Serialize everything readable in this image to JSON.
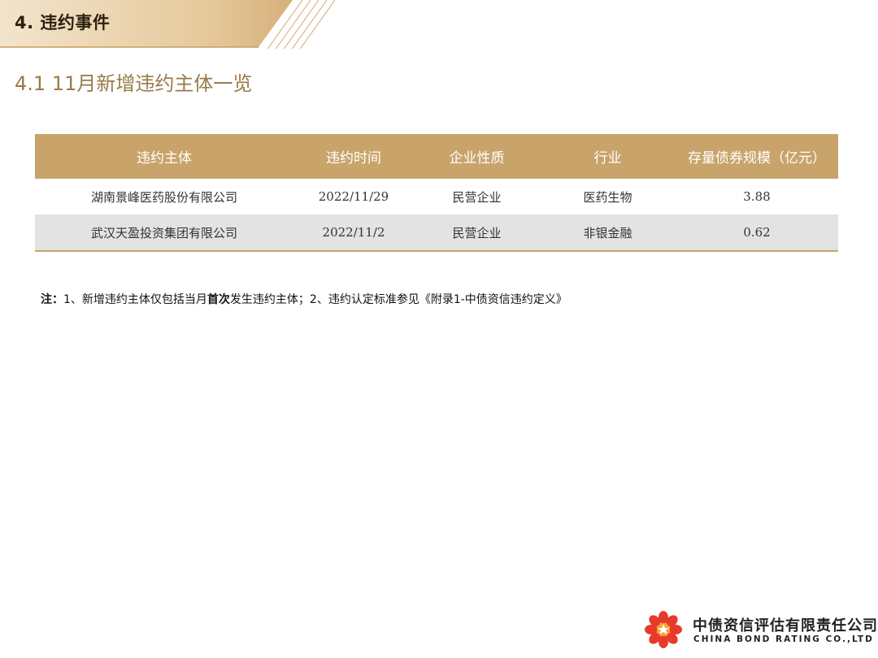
{
  "header": {
    "section_title": "4. 违约事件",
    "subtitle": "4.1 11月新增违约主体一览"
  },
  "table": {
    "columns": [
      "违约主体",
      "违约时间",
      "企业性质",
      "行业",
      "存量债券规模（亿元）"
    ],
    "rows": [
      [
        "湖南景峰医药股份有限公司",
        "2022/11/29",
        "民营企业",
        "医药生物",
        "3.88"
      ],
      [
        "武汉天盈投资集团有限公司",
        "2022/11/2",
        "民营企业",
        "非银金融",
        "0.62"
      ]
    ]
  },
  "note": {
    "label": "注：",
    "part1": "1、新增违约主体仅包括当月",
    "bold": "首次",
    "part2": "发生违约主体；2、违约认定标准参见《附录1-中债资信违约定义》"
  },
  "logo": {
    "name_cn": "中债资信评估有限责任公司",
    "name_en": "CHINA BOND RATING CO.,LTD"
  },
  "colors": {
    "gold": "#c8a46a",
    "banner_gold": "#d9b98a",
    "subtitle": "#9a7a4a",
    "logo_red": "#e83a2a"
  }
}
